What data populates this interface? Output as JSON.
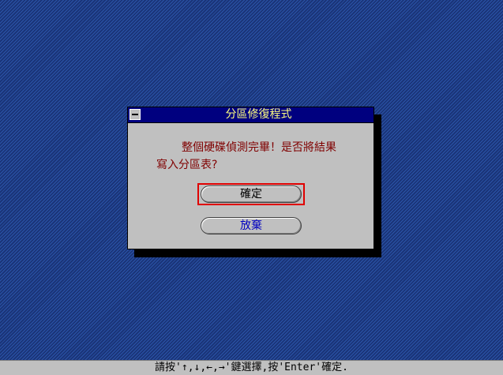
{
  "dialog": {
    "title": "分區修復程式",
    "message_line1": "整個硬碟偵測完畢！是否將結果",
    "message_line2": "寫入分區表?",
    "buttons": {
      "confirm_label": "確定",
      "discard_label": "放棄"
    }
  },
  "status_bar": {
    "text": "請按'↑,↓,←,→'鍵選擇,按'Enter'確定."
  },
  "icons": {
    "system_menu": "system-menu-icon"
  },
  "colors": {
    "desktop": "#1f3f8c",
    "title_bar": "#00007f",
    "title_text": "#ffff80",
    "message_text": "#800000",
    "focus_border": "#e00000",
    "discard_text": "#0000c0",
    "dialog_face": "#c0c0c0"
  }
}
